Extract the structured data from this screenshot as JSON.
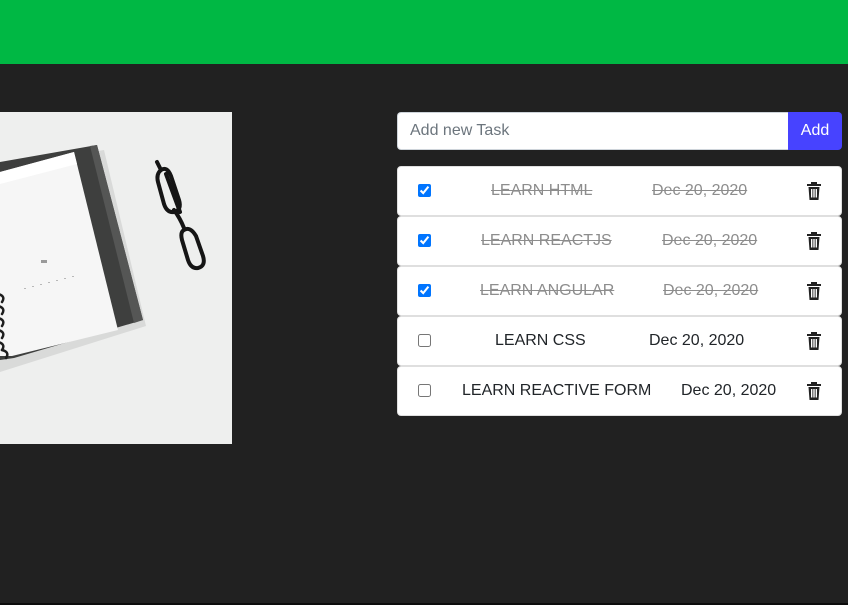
{
  "colors": {
    "header_bg": "#00b844",
    "page_bg": "#212121",
    "add_button_bg": "#4743ff"
  },
  "photo": {
    "icon": "notebook-and-glasses-photo"
  },
  "form": {
    "placeholder": "Add new Task",
    "value": "",
    "add_label": "Add"
  },
  "tasks": [
    {
      "title": "LEARN HTML",
      "date": "Dec 20, 2020",
      "done": true,
      "icon": "trash-icon"
    },
    {
      "title": "LEARN REACTJS",
      "date": "Dec 20, 2020",
      "done": true,
      "icon": "trash-icon"
    },
    {
      "title": "LEARN ANGULAR",
      "date": "Dec 20, 2020",
      "done": true,
      "icon": "trash-icon"
    },
    {
      "title": "LEARN CSS",
      "date": "Dec 20, 2020",
      "done": false,
      "icon": "trash-icon"
    },
    {
      "title": "LEARN REACTIVE FORM",
      "date": "Dec 20, 2020",
      "done": false,
      "icon": "trash-icon"
    }
  ]
}
